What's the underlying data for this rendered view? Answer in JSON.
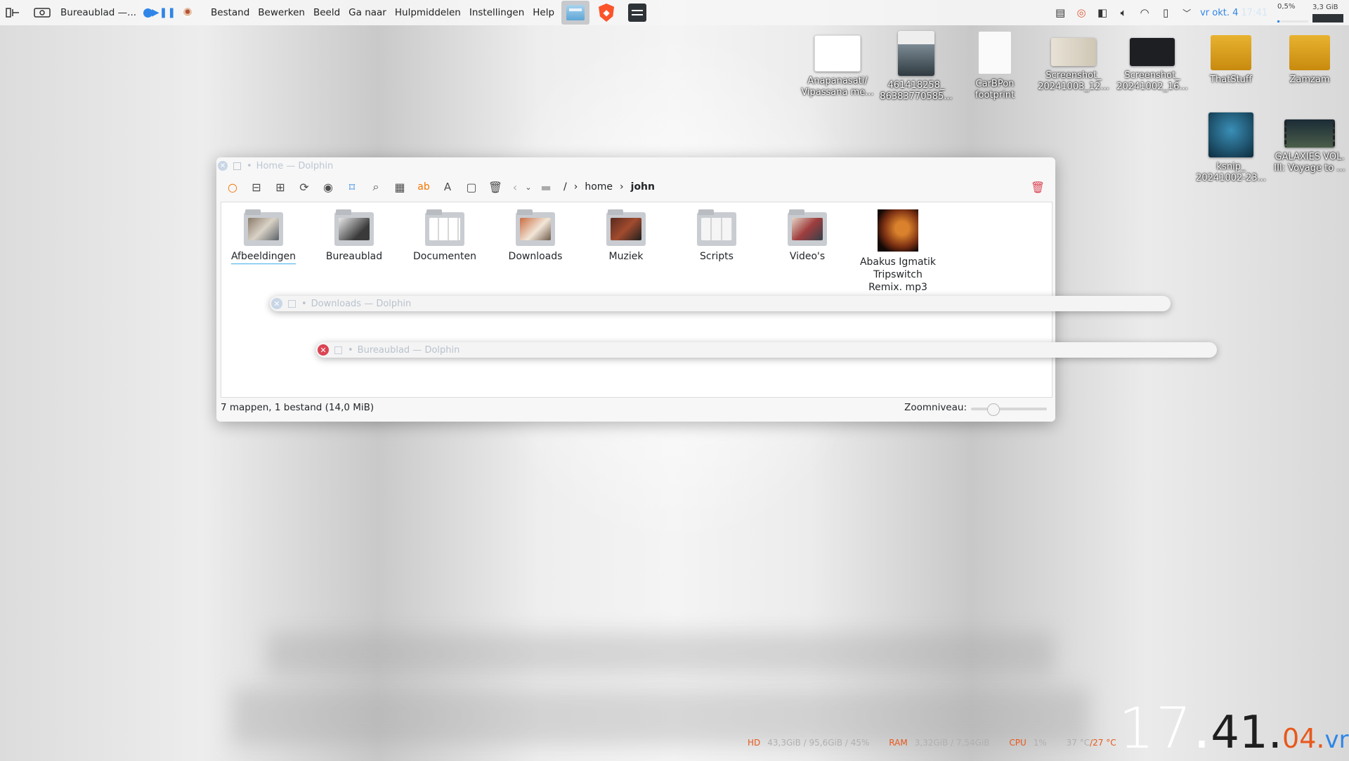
{
  "top_panel": {
    "active_window": "Bureaublad —...",
    "menu": [
      "Bestand",
      "Bewerken",
      "Beeld",
      "Ga naar",
      "Hulpmiddelen",
      "Instellingen",
      "Help"
    ],
    "date": "vr okt. 4",
    "time": "17:41",
    "cpu_mini": "0,5%",
    "ram_mini": "3,3 GiB"
  },
  "desktop_icons": [
    {
      "label": "Anapanasati/ Vipassana me..."
    },
    {
      "label": "461418258_ 86383770585..."
    },
    {
      "label": "CarBPon footprint"
    },
    {
      "label": "Screenshot_ 20241003_12..."
    },
    {
      "label": "Screenshot_ 20241002_16..."
    },
    {
      "label": "ThatStuff"
    },
    {
      "label": "Zamzam"
    },
    {
      "label": "ksnip_ 20241002-23..."
    },
    {
      "label": "GALAXIES VOL. III: Voyage to ..."
    }
  ],
  "window": {
    "title": "Home — Dolphin",
    "breadcrumb": {
      "root": "/",
      "segments": [
        "home",
        "john"
      ]
    },
    "items": [
      {
        "name": "Afbeeldingen"
      },
      {
        "name": "Bureaublad"
      },
      {
        "name": "Documenten"
      },
      {
        "name": "Downloads"
      },
      {
        "name": "Muziek"
      },
      {
        "name": "Scripts"
      },
      {
        "name": "Video's"
      },
      {
        "name": "Abakus Igmatik Tripswitch Remix. mp3"
      }
    ],
    "status": "7 mappen, 1 bestand (14,0 MiB)",
    "zoom_label": "Zoomniveau:",
    "zoom_level": 0.25
  },
  "shaded_windows": [
    {
      "title": "Downloads — Dolphin"
    },
    {
      "title": "Bureaublad — Dolphin"
    }
  ],
  "bottom_stats": {
    "hd_label": "HD",
    "hd_value": "43,3GiB / 95,6GiB / 45%",
    "ram_label": "RAM",
    "ram_value": "3,32GiB / 7,54GiB",
    "cpu_label": "CPU",
    "cpu_value": "1%",
    "temp_a": "37 °C",
    "temp_b": "/27 °C"
  },
  "clock": {
    "hours": "17",
    "minutes": "41",
    "seconds": "04",
    "day": "vr"
  },
  "colors": {
    "accent": "#3daee9",
    "orange": "#e8581b",
    "close_red": "#da4453"
  }
}
